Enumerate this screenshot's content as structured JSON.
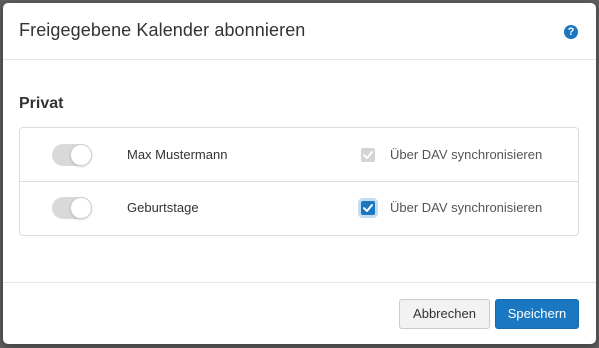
{
  "dialog": {
    "title": "Freigegebene Kalender abonnieren",
    "help_icon": "?"
  },
  "section": {
    "title": "Privat"
  },
  "calendars": [
    {
      "name": "Max Mustermann",
      "subscribed": true,
      "sync_label": "Über DAV synchronisieren",
      "sync_checked": true,
      "sync_disabled": true
    },
    {
      "name": "Geburtstage",
      "subscribed": true,
      "sync_label": "Über DAV synchronisieren",
      "sync_checked": true,
      "sync_disabled": false
    }
  ],
  "footer": {
    "cancel_label": "Abbrechen",
    "save_label": "Speichern"
  },
  "colors": {
    "accent": "#1a78c2",
    "toggle_track": "#d9d9d9",
    "disabled_checkbox": "#d4d4d4"
  }
}
